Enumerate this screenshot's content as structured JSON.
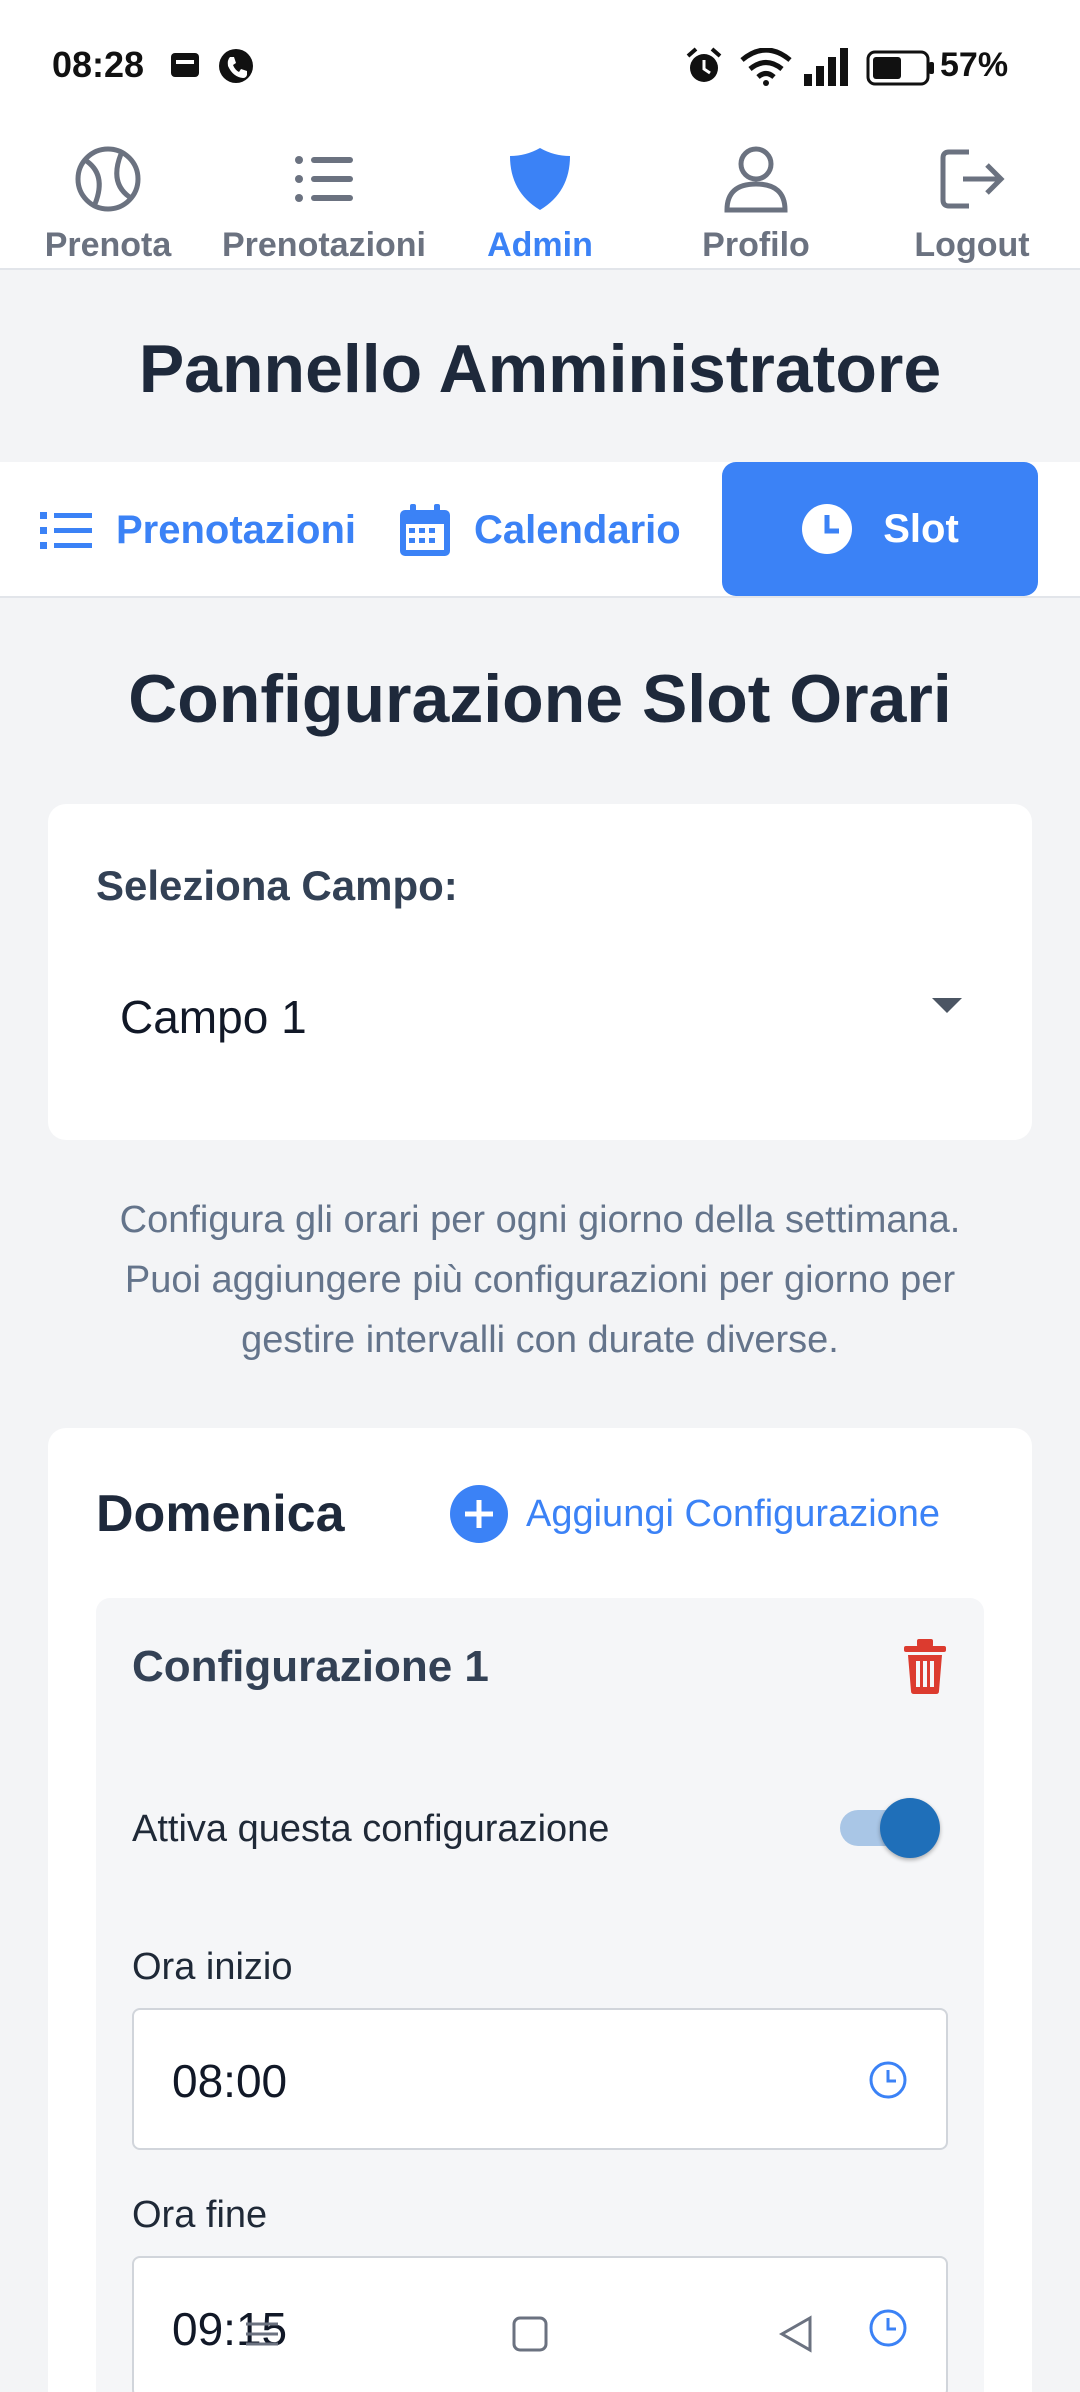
{
  "status_bar": {
    "time": "08:28",
    "battery_percent": "57%",
    "battery_level": 0.57,
    "icons": [
      "sim-card-icon",
      "phone-icon",
      "alarm-icon",
      "wifi-icon",
      "signal-icon",
      "battery-icon"
    ]
  },
  "top_nav": {
    "items": [
      {
        "label": "Prenota",
        "icon": "tennis-ball-icon",
        "active": false
      },
      {
        "label": "Prenotazioni",
        "icon": "list-icon",
        "active": false
      },
      {
        "label": "Admin",
        "icon": "shield-icon",
        "active": true
      },
      {
        "label": "Profilo",
        "icon": "user-icon",
        "active": false
      },
      {
        "label": "Logout",
        "icon": "logout-icon",
        "active": false
      }
    ]
  },
  "page_title": "Pannello Amministratore",
  "sub_tabs": [
    {
      "label": "Prenotazioni",
      "icon": "list-icon",
      "active": false
    },
    {
      "label": "Calendario",
      "icon": "calendar-icon",
      "active": false
    },
    {
      "label": "Slot",
      "icon": "clock-icon",
      "active": true
    }
  ],
  "section_title": "Configurazione Slot Orari",
  "campo": {
    "label": "Seleziona Campo:",
    "selected": "Campo 1"
  },
  "info_lines": [
    "Configura gli orari per ogni giorno della settimana.",
    "Puoi aggiungere più configurazioni per giorno per",
    "gestire intervalli con durate diverse."
  ],
  "day": {
    "name": "Domenica",
    "add_label": "Aggiungi Configurazione",
    "configuration": {
      "title": "Configurazione 1",
      "toggle_label": "Attiva questa configurazione",
      "toggle_on": true,
      "start_label": "Ora inizio",
      "start_value": "08:00",
      "end_label": "Ora fine",
      "end_value": "09:15"
    }
  },
  "colors": {
    "accent": "#3b82f6",
    "danger": "#dc3b2f",
    "text_dark": "#1e293b",
    "muted": "#64748b",
    "toggle": "#1f6fb9"
  }
}
